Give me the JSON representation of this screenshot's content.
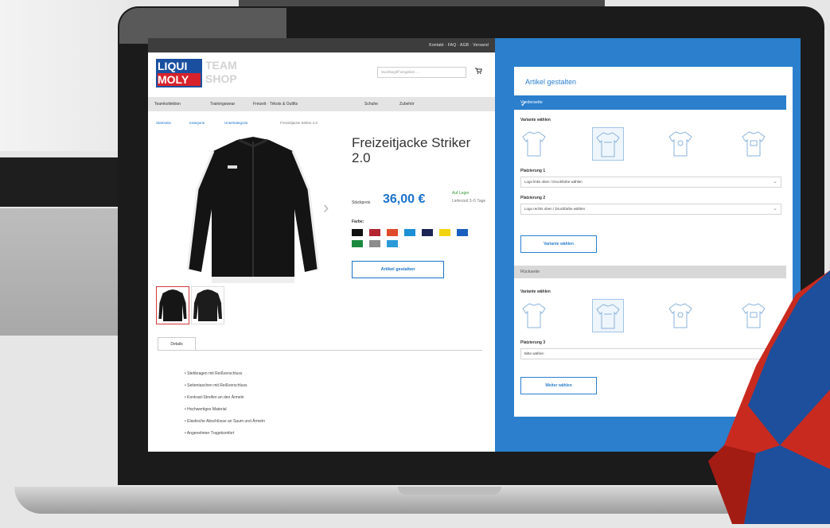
{
  "site": {
    "topbar_text": "Kontakt · FAQ · AGB · Versand",
    "logo": {
      "line1": "LIQUI",
      "line2": "MOLY",
      "team_text": "TEAM SHOP"
    },
    "search_placeholder": "Suchbegriff eingeben …",
    "cart_icon": "cart-icon",
    "nav": [
      "Teamkollektion",
      "Trainingswear",
      "Freizeit · Trikots & Outfits",
      "Schuhe",
      "Zubehör"
    ],
    "breadcrumbs": [
      "Startseite",
      "Kategorie",
      "Unterkategorie",
      "Freizeitjacke Striker 2.0"
    ]
  },
  "product": {
    "title": "Freizeitjacke Striker 2.0",
    "price_label": "Stückpreis",
    "price": "36,00 €",
    "stock": "Auf Lager",
    "stock_sub": "Lieferzeit 3–5 Tage",
    "color_label": "Farbe:",
    "swatches": [
      "#111111",
      "#b32630",
      "#e04a2b",
      "#1d8fd6",
      "#1c2455",
      "#f1d40f",
      "#1a5fbf",
      "#1b8a3e",
      "#8c8c8c",
      "#2b9ad8"
    ],
    "design_button": "Artikel gestalten",
    "tab_label": "Details",
    "bullets": [
      "Stehkragen mit Reißverschluss",
      "Seitentaschen mit Reißverschluss",
      "Kontrast-Streifen an den Ärmeln",
      "Hochwertiges Material",
      "Elastische Abschlüsse an Saum und Ärmeln",
      "Angenehmer Tragekomfort"
    ]
  },
  "designer": {
    "heading": "Artikel gestalten",
    "section1": "Vorderseite",
    "choose_variant": "Variante wählen",
    "print1_label": "Platzierung 1",
    "print1_value": "Logo links oben / Druckfarbe wählen",
    "print2_label": "Platzierung 2",
    "print2_value": "Logo rechts oben / Druckfarbe wählen",
    "apply_button": "Variante wählen",
    "section2": "Rückseite",
    "print3_label": "Platzierung 3",
    "print3_value": "Bitte wählen",
    "back_button": "Weiter wählen"
  }
}
